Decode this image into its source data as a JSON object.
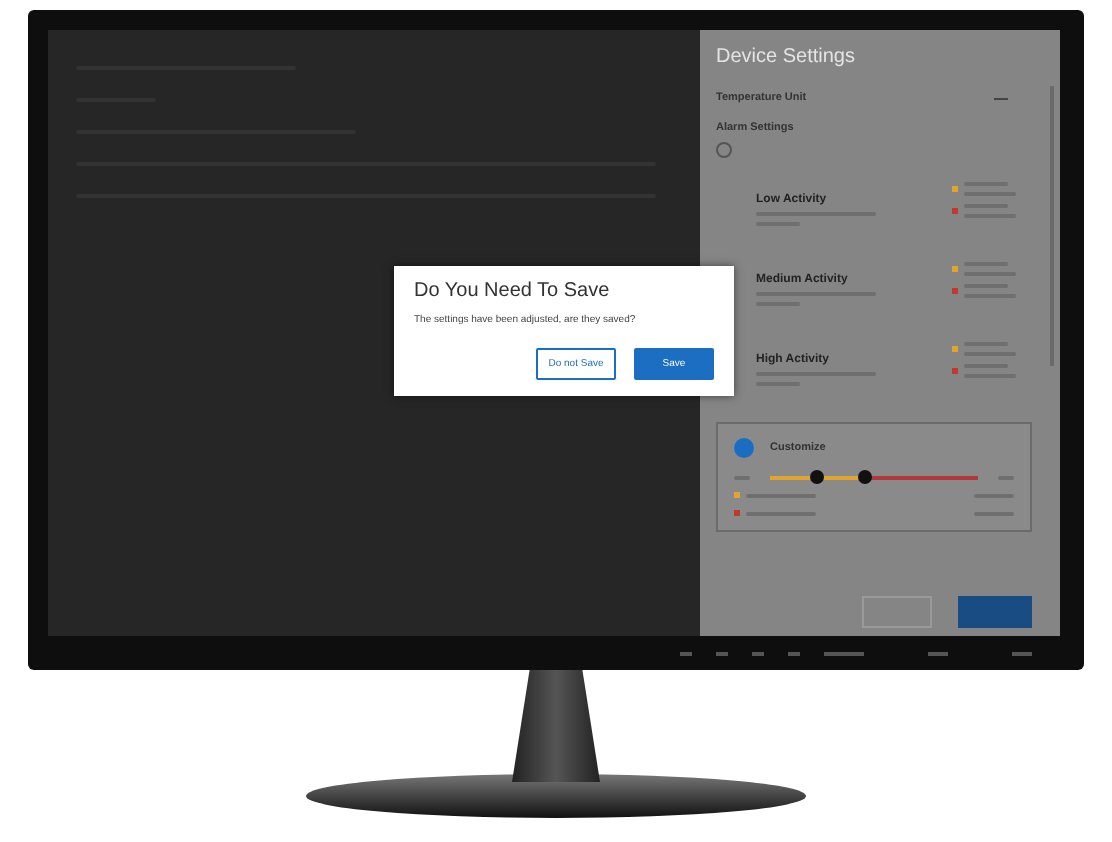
{
  "dialog": {
    "title": "Do You Need To Save",
    "message": "The settings have been adjusted, are they saved?",
    "buttons": [
      {
        "label": "Do not Save",
        "kind": "secondary"
      },
      {
        "label": "Save",
        "kind": "primary"
      }
    ]
  },
  "settings_panel": {
    "title": "Device Settings",
    "temperature_unit": {
      "label": "Temperature Unit"
    },
    "alarm_settings": {
      "label": "Alarm Settings",
      "checked": false
    },
    "activities": [
      {
        "name": "Low Activity",
        "markers": [
          {
            "color": "#e0a52e"
          },
          {
            "color": "#c0392b"
          }
        ]
      },
      {
        "name": "Medium Activity",
        "markers": [
          {
            "color": "#e0a52e"
          },
          {
            "color": "#c0392b"
          }
        ]
      },
      {
        "name": "High Activity",
        "markers": [
          {
            "color": "#e0a52e"
          },
          {
            "color": "#c0392b"
          }
        ]
      }
    ],
    "customize": {
      "label": "Customize",
      "checked": true,
      "thumbs": [
        {
          "level": 0.22
        },
        {
          "level": 0.45
        }
      ],
      "legend": [
        {
          "color": "#e0a52e"
        },
        {
          "color": "#c0392b"
        }
      ]
    }
  }
}
